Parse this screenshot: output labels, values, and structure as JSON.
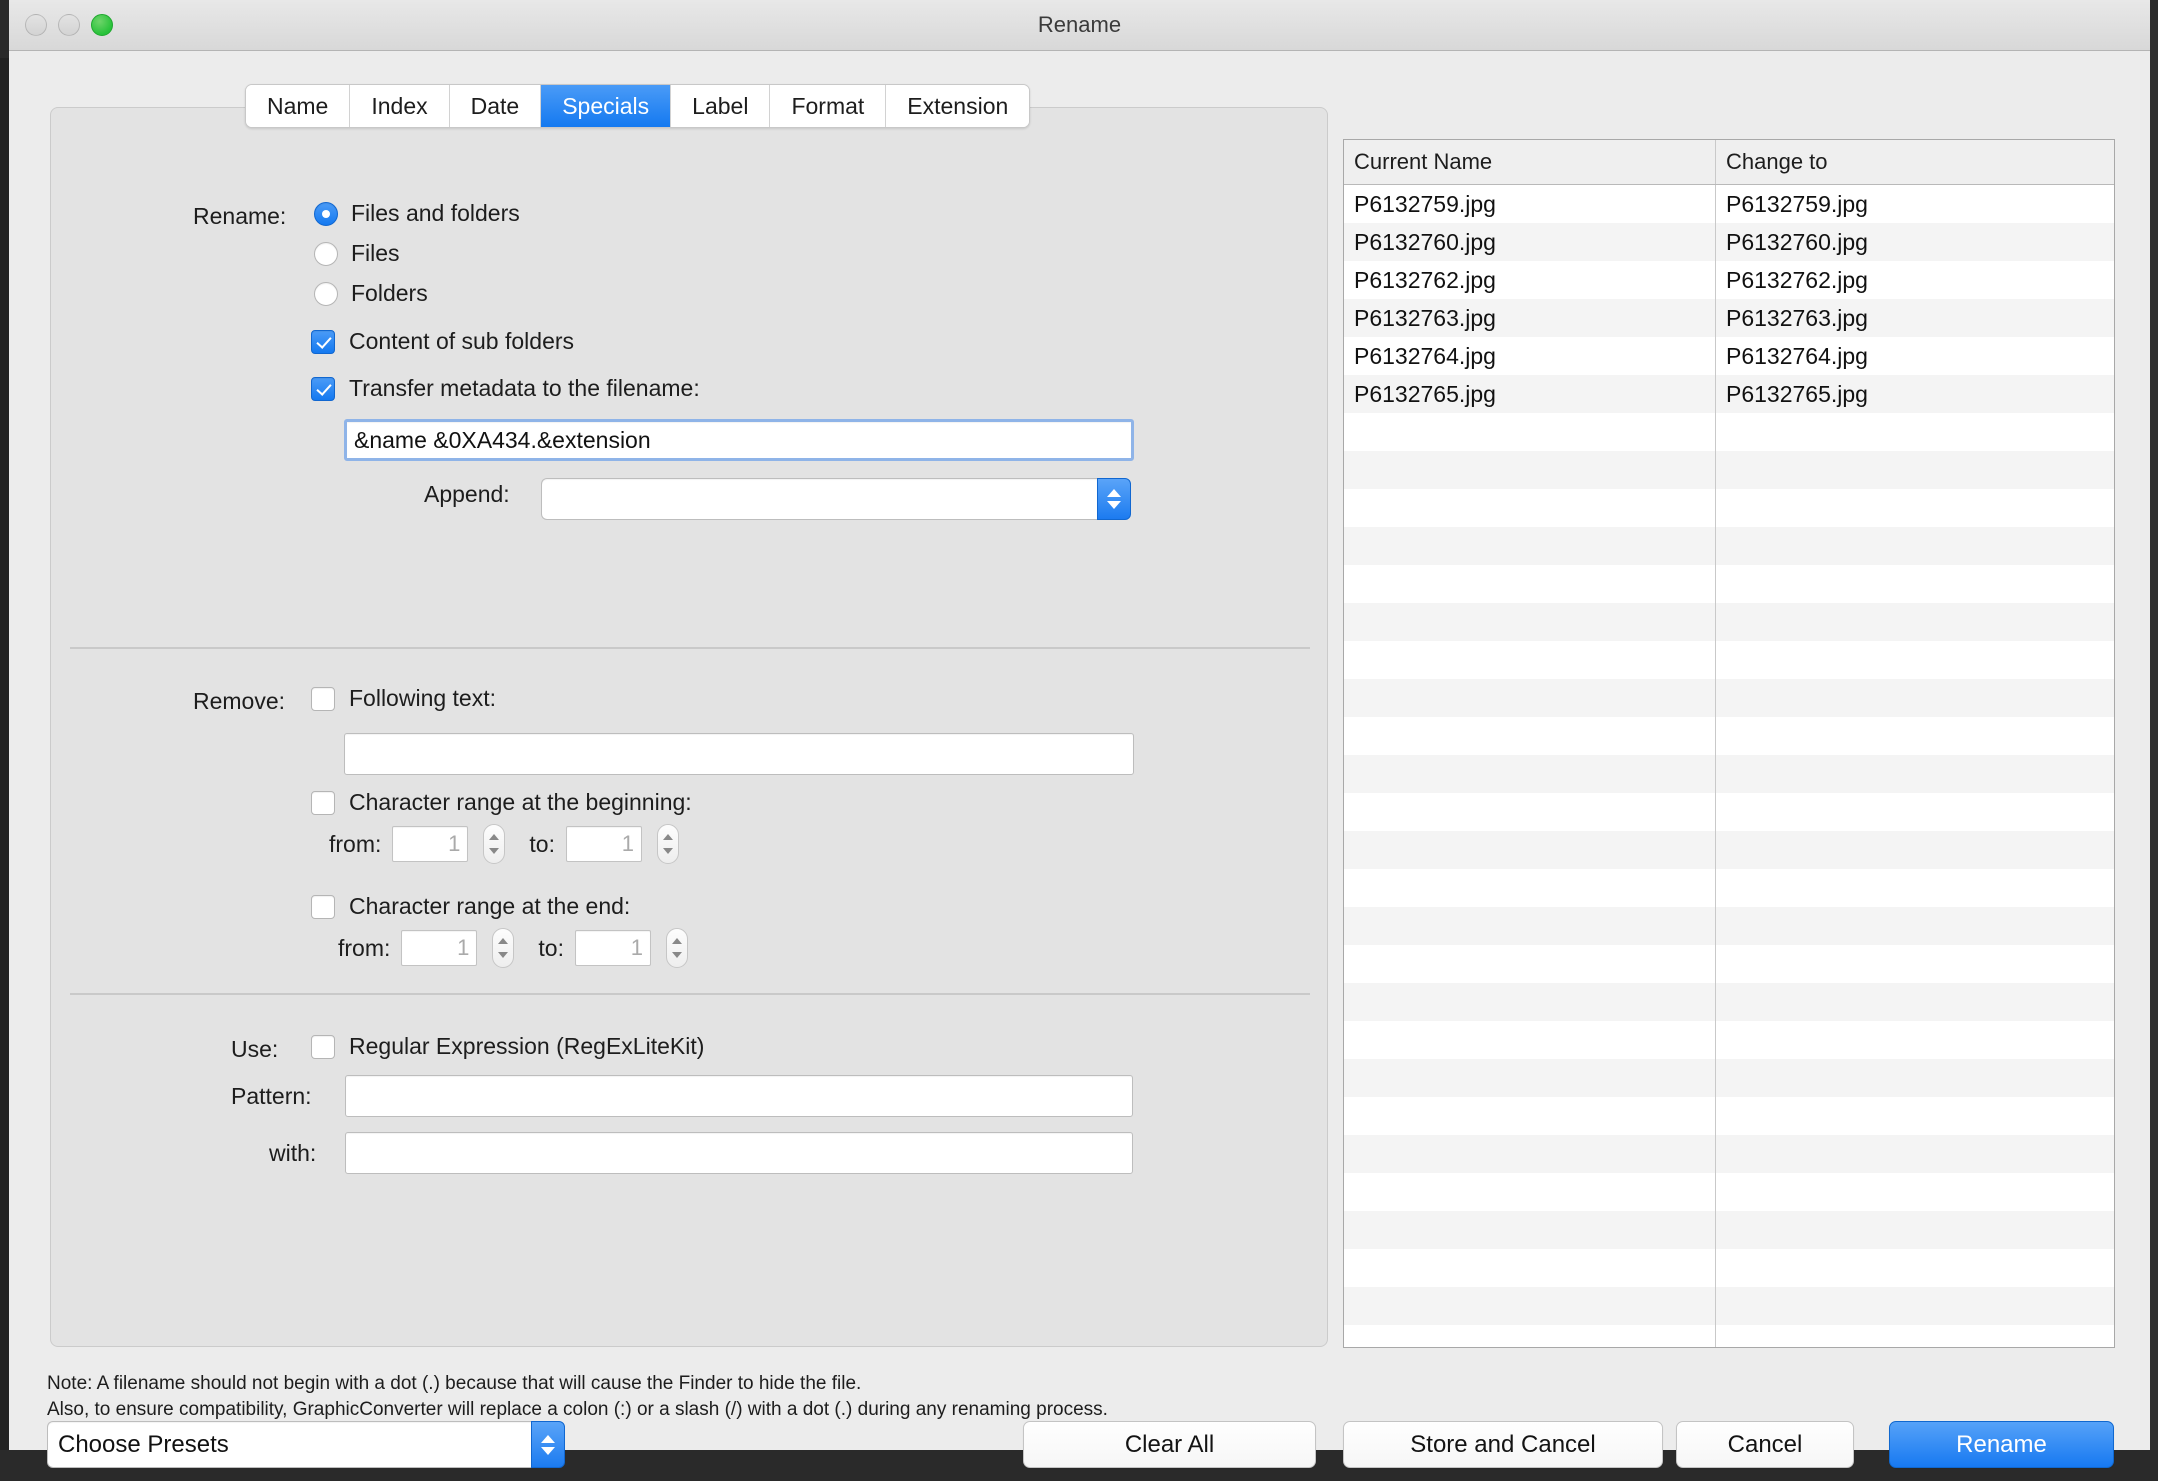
{
  "window": {
    "title": "Rename",
    "traffic_lights": [
      "close",
      "minimize",
      "zoom"
    ]
  },
  "tabs": [
    {
      "label": "Name",
      "active": false
    },
    {
      "label": "Index",
      "active": false
    },
    {
      "label": "Date",
      "active": false
    },
    {
      "label": "Specials",
      "active": true
    },
    {
      "label": "Label",
      "active": false
    },
    {
      "label": "Format",
      "active": false
    },
    {
      "label": "Extension",
      "active": false
    }
  ],
  "rename_section": {
    "label": "Rename:",
    "radios": [
      {
        "label": "Files and folders",
        "checked": true
      },
      {
        "label": "Files",
        "checked": false
      },
      {
        "label": "Folders",
        "checked": false
      }
    ],
    "checkboxes": [
      {
        "label": "Content of sub folders",
        "checked": true
      },
      {
        "label": "Transfer metadata to the filename:",
        "checked": true
      }
    ],
    "metadata_field": {
      "value": "&name &0XA434.&extension",
      "placeholder": ""
    },
    "append": {
      "label": "Append:",
      "value": "",
      "placeholder": ""
    }
  },
  "remove_section": {
    "label": "Remove:",
    "following_text": {
      "label": "Following text:",
      "checked": false,
      "value": "",
      "placeholder": ""
    },
    "range_beginning": {
      "label": "Character range at the beginning:",
      "checked": false,
      "from_label": "from:",
      "from_value": "1",
      "to_label": "to:",
      "to_value": "1"
    },
    "range_end": {
      "label": "Character range at the end:",
      "checked": false,
      "from_label": "from:",
      "from_value": "1",
      "to_label": "to:",
      "to_value": "1"
    }
  },
  "use_section": {
    "label": "Use:",
    "regex": {
      "label": "Regular Expression (RegExLiteKit)",
      "checked": false
    },
    "pattern": {
      "label": "Pattern:",
      "value": "",
      "placeholder": ""
    },
    "with": {
      "label": "with:",
      "value": "",
      "placeholder": ""
    }
  },
  "table": {
    "columns": [
      "Current Name",
      "Change to"
    ],
    "rows": [
      {
        "current": "P6132759.jpg",
        "change_to": "P6132759.jpg"
      },
      {
        "current": "P6132760.jpg",
        "change_to": "P6132760.jpg"
      },
      {
        "current": "P6132762.jpg",
        "change_to": "P6132762.jpg"
      },
      {
        "current": "P6132763.jpg",
        "change_to": "P6132763.jpg"
      },
      {
        "current": "P6132764.jpg",
        "change_to": "P6132764.jpg"
      },
      {
        "current": "P6132765.jpg",
        "change_to": "P6132765.jpg"
      }
    ]
  },
  "note": {
    "line1": "Note: A filename should not begin with a dot (.) because that will cause the Finder to hide the file.",
    "line2": "Also, to ensure compatibility, GraphicConverter will replace a colon (:) or a slash (/) with a dot (.) during any renaming process."
  },
  "footer": {
    "presets": {
      "value": "Choose Presets"
    },
    "clear_all": "Clear All",
    "store_and_cancel": "Store and Cancel",
    "cancel": "Cancel",
    "rename": "Rename"
  },
  "colors": {
    "accent": "#1479f0",
    "window_bg": "#ececec",
    "group_bg": "#e3e3e3",
    "traffic_green": "#28c23a"
  }
}
